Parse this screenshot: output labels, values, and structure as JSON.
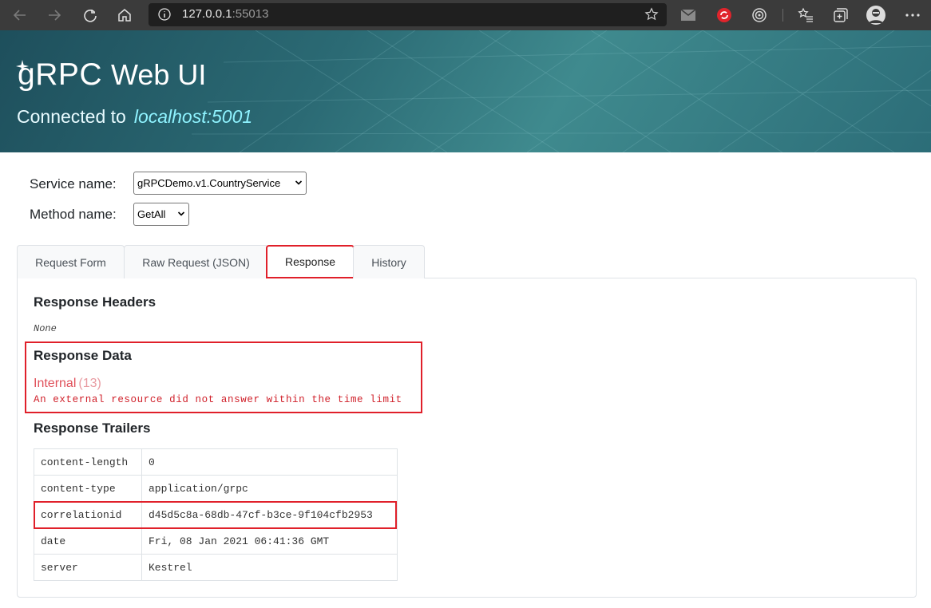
{
  "browser": {
    "url_host": "127.0.0.1",
    "url_port": ":55013",
    "icons": [
      "back-icon",
      "forward-icon",
      "refresh-icon",
      "home-icon",
      "info-icon",
      "favorite-star-icon",
      "mail-icon",
      "extension-icon",
      "tracking-icon",
      "favorites-list-icon",
      "collections-icon",
      "profile-avatar",
      "more-icon"
    ]
  },
  "header": {
    "logo": "gRPC",
    "title": "Web UI",
    "connected_label": "Connected to",
    "connected_host": "localhost:5001"
  },
  "form": {
    "service_label": "Service name:",
    "service_value": "gRPCDemo.v1.CountryService",
    "method_label": "Method name:",
    "method_value": "GetAll"
  },
  "tabs": [
    {
      "label": "Request Form"
    },
    {
      "label": "Raw Request (JSON)"
    },
    {
      "label": "Response",
      "active": true
    },
    {
      "label": "History"
    }
  ],
  "response": {
    "headers_title": "Response Headers",
    "headers_none": "None",
    "data_title": "Response Data",
    "status_name": "Internal",
    "status_code": "(13)",
    "status_message": "An external resource did not answer within the time limit",
    "trailers_title": "Response Trailers",
    "trailers": [
      {
        "key": "content-length",
        "value": "0"
      },
      {
        "key": "content-type",
        "value": "application/grpc"
      },
      {
        "key": "correlationid",
        "value": "d45d5c8a-68db-47cf-b3ce-9f104cfb2953",
        "highlighted": true
      },
      {
        "key": "date",
        "value": "Fri, 08 Jan 2021 06:41:36 GMT"
      },
      {
        "key": "server",
        "value": "Kestrel"
      }
    ]
  },
  "colors": {
    "highlight": "#e0202a",
    "error_text": "#d0202a",
    "banner": "#2b6a74"
  }
}
